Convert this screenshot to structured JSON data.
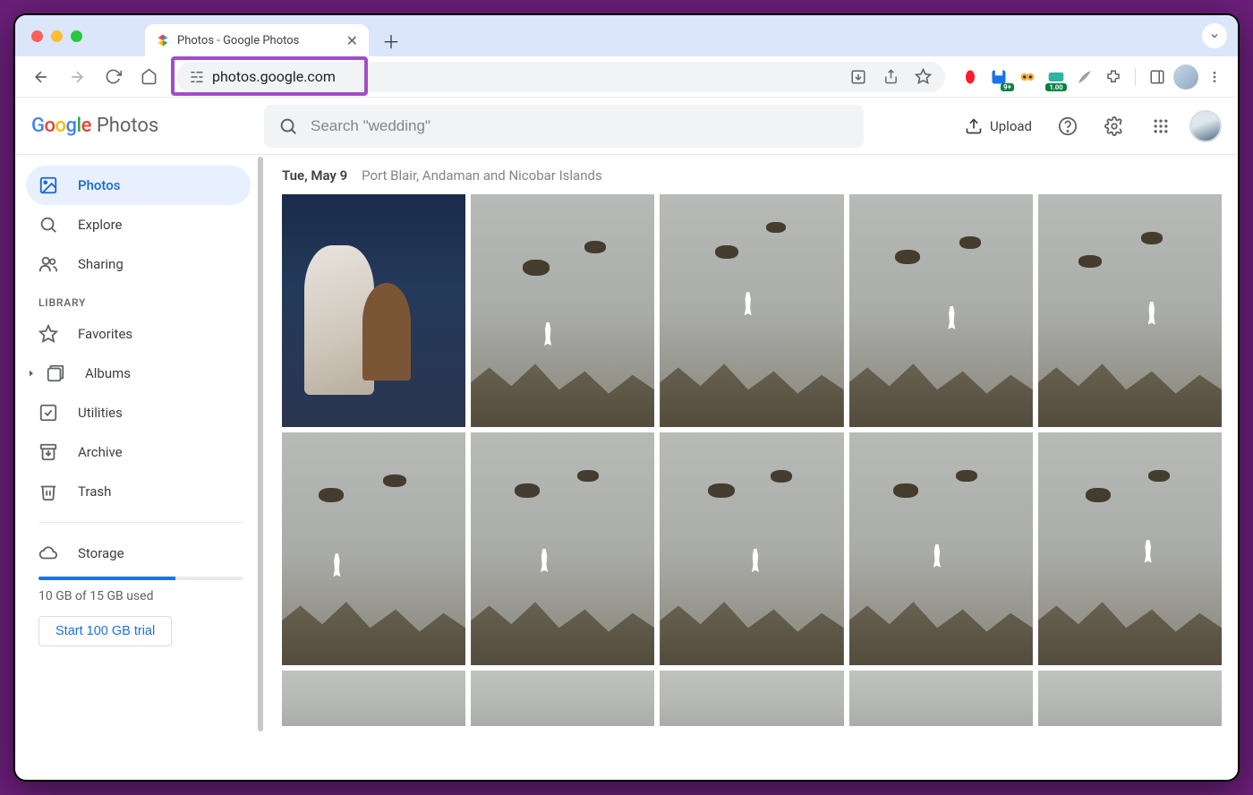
{
  "browser": {
    "tab_title": "Photos - Google Photos",
    "url": "photos.google.com",
    "ext_badge": "9+",
    "ext_rate": "1.00"
  },
  "brand": {
    "google": "Google",
    "product": "Photos"
  },
  "search": {
    "placeholder": "Search \"wedding\""
  },
  "header": {
    "upload": "Upload"
  },
  "sidebar": {
    "items": [
      {
        "label": "Photos",
        "active": true
      },
      {
        "label": "Explore"
      },
      {
        "label": "Sharing"
      }
    ],
    "library_label": "LIBRARY",
    "library": [
      {
        "label": "Favorites"
      },
      {
        "label": "Albums"
      },
      {
        "label": "Utilities"
      },
      {
        "label": "Archive"
      },
      {
        "label": "Trash"
      }
    ],
    "storage_label": "Storage",
    "storage_used_text": "10 GB of 15 GB used",
    "storage_used_gb": 10,
    "storage_total_gb": 15,
    "trial_button": "Start 100 GB trial"
  },
  "gallery": {
    "date": "Tue, May 9",
    "location": "Port Blair, Andaman and Nicobar Islands"
  }
}
